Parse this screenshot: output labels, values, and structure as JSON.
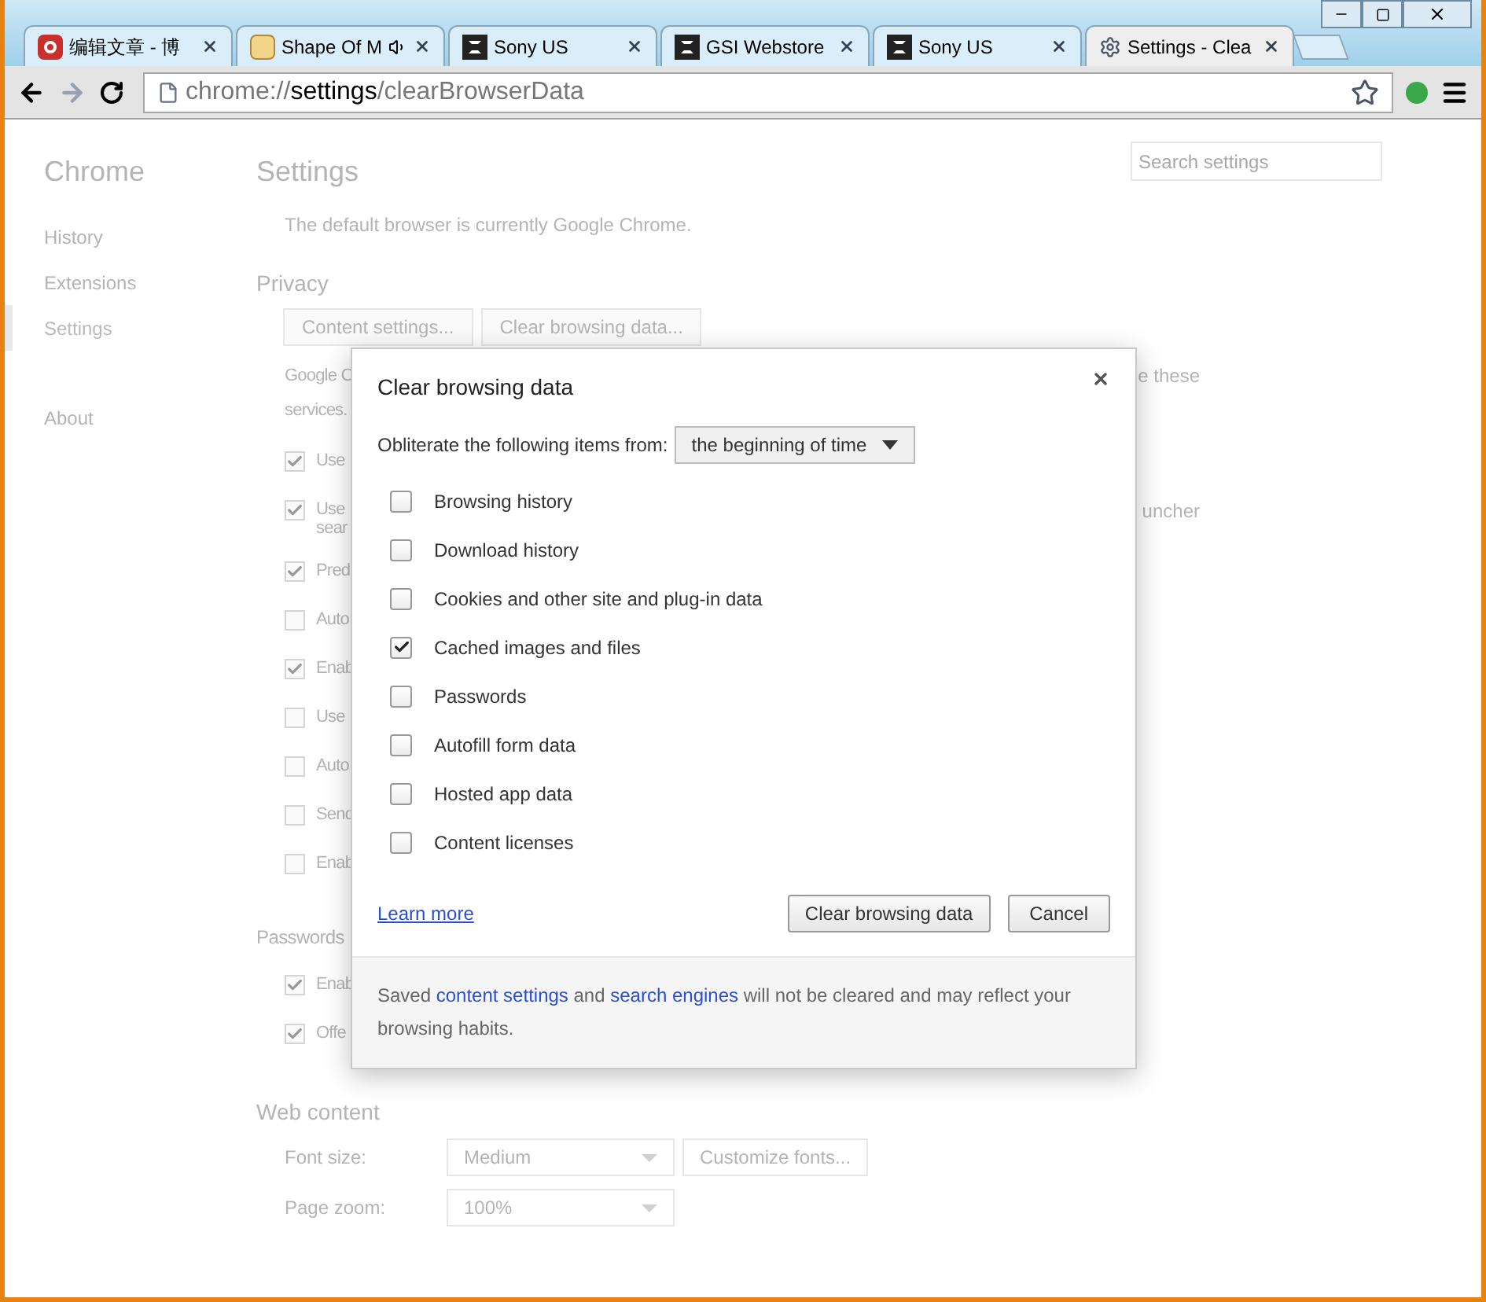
{
  "window": {
    "tabs": [
      {
        "title": "编辑文章 - 博",
        "kind": "red",
        "selected": false,
        "audio": false
      },
      {
        "title": "Shape Of M",
        "kind": "page",
        "selected": false,
        "audio": true
      },
      {
        "title": "Sony US",
        "kind": "dark",
        "selected": false,
        "audio": false
      },
      {
        "title": "GSI Webstore",
        "kind": "dark",
        "selected": false,
        "audio": false
      },
      {
        "title": "Sony US",
        "kind": "dark",
        "selected": false,
        "audio": false
      },
      {
        "title": "Settings - Clea",
        "kind": "gear",
        "selected": true,
        "audio": false
      }
    ]
  },
  "address_bar": {
    "scheme": "chrome://",
    "host": "settings",
    "path": "/clearBrowserData"
  },
  "sidebar": {
    "title": "Chrome",
    "items": [
      {
        "label": "History",
        "selected": false
      },
      {
        "label": "Extensions",
        "selected": false
      },
      {
        "label": "Settings",
        "selected": true
      },
      {
        "label": "About",
        "selected": false
      }
    ]
  },
  "settings": {
    "title": "Settings",
    "search": {
      "placeholder": "Search settings"
    },
    "default_browser": "The default browser is currently Google Chrome.",
    "privacy": {
      "heading": "Privacy",
      "buttons": [
        "Content settings...",
        "Clear browsing data..."
      ],
      "rows": [
        {
          "kind": "text",
          "text": "Google C",
          "right_text": "e these"
        },
        {
          "kind": "text",
          "text": "services."
        },
        {
          "kind": "checkbox",
          "text": "Use",
          "checked": true
        },
        {
          "kind": "checkbox",
          "text": "Use",
          "right_text": "uncher",
          "checked": true
        },
        {
          "kind": "text",
          "text": "sear"
        },
        {
          "kind": "checkbox",
          "text": "Pred",
          "checked": true
        },
        {
          "kind": "checkbox",
          "text": "Auto",
          "checked": false
        },
        {
          "kind": "checkbox",
          "text": "Enab",
          "checked": true
        },
        {
          "kind": "checkbox",
          "text": "Use",
          "checked": false
        },
        {
          "kind": "checkbox",
          "text": "Auto",
          "checked": false
        },
        {
          "kind": "checkbox",
          "text": "Send",
          "checked": false
        },
        {
          "kind": "checkbox",
          "text": "Enab",
          "checked": false
        }
      ]
    },
    "passwords": {
      "heading": "Passwords",
      "rows": [
        {
          "text": "Enab",
          "checked": true
        },
        {
          "text": "Offe",
          "checked": true
        }
      ]
    },
    "web_content": {
      "heading": "Web content",
      "font_size": {
        "label": "Font size:",
        "value": "Medium",
        "button": "Customize fonts..."
      },
      "page_zoom": {
        "label": "Page zoom:",
        "value": "100%"
      }
    }
  },
  "dialog": {
    "title": "Clear browsing data",
    "range_label": "Obliterate the following items from:",
    "range_value": "the beginning of time",
    "items": [
      {
        "label": "Browsing history",
        "checked": false
      },
      {
        "label": "Download history",
        "checked": false
      },
      {
        "label": "Cookies and other site and plug-in data",
        "checked": false
      },
      {
        "label": "Cached images and files",
        "checked": true
      },
      {
        "label": "Passwords",
        "checked": false
      },
      {
        "label": "Autofill form data",
        "checked": false
      },
      {
        "label": "Hosted app data",
        "checked": false
      },
      {
        "label": "Content licenses",
        "checked": false
      }
    ],
    "learn_more": "Learn more",
    "buttons": [
      "Clear browsing data",
      "Cancel"
    ],
    "footer": [
      "Saved ",
      "content settings",
      " and ",
      "search engines",
      " will not be cleared and may reflect your browsing habits."
    ]
  }
}
